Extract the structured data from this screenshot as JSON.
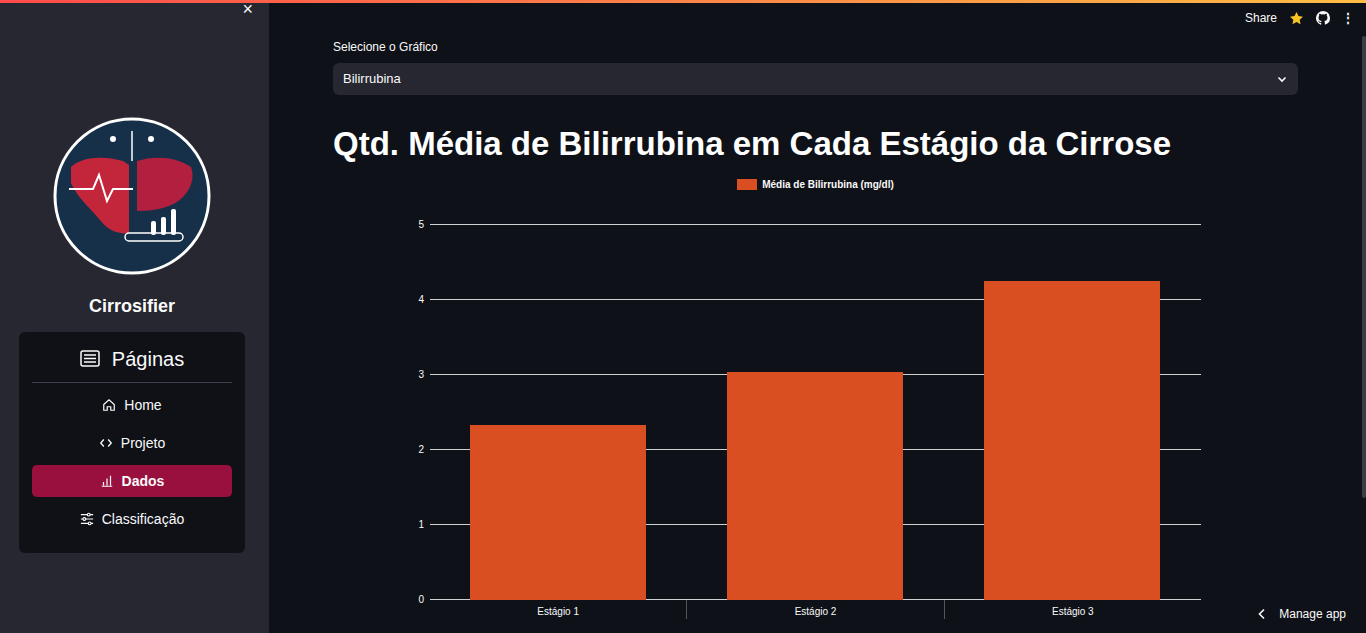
{
  "sidebar": {
    "close": "×",
    "app_name": "Cirrosifier",
    "menu": {
      "title": "Páginas",
      "items": [
        {
          "label": "Home",
          "selected": false,
          "kind": "home"
        },
        {
          "label": "Projeto",
          "selected": false,
          "kind": "code"
        },
        {
          "label": "Dados",
          "selected": true,
          "kind": "chart"
        },
        {
          "label": "Classificação",
          "selected": false,
          "kind": "sliders"
        }
      ]
    }
  },
  "toolbar": {
    "share": "Share",
    "more": "⋮"
  },
  "select": {
    "label": "Selecione o Gráfico",
    "value": "Bilirrubina"
  },
  "chart": {
    "title": "Qtd. Média de Bilirrubina em Cada Estágio da Cirrose",
    "y_ticks": [
      "0",
      "1",
      "2",
      "3",
      "4",
      "5"
    ],
    "categories": [
      "Estágio 1",
      "Estágio 2",
      "Estágio 3"
    ],
    "series": [
      {
        "name": "Média de Bilirrubina (mg/dl)",
        "values": [
          2.33,
          3.04,
          4.25
        ]
      }
    ]
  },
  "footer": {
    "manage": "Manage app"
  }
}
